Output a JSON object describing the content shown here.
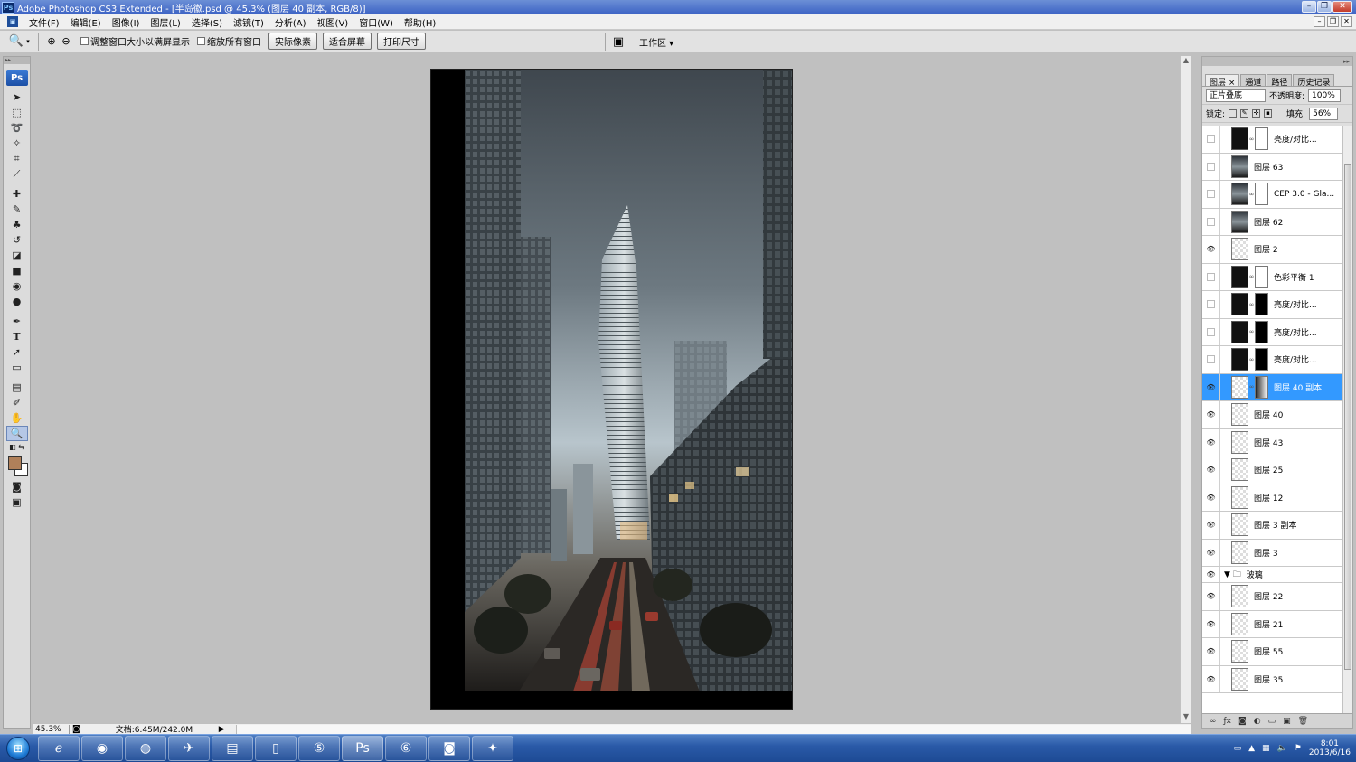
{
  "window": {
    "title": "Adobe Photoshop CS3 Extended - [半岛徽.psd @ 45.3% (图层 40 副本, RGB/8)]",
    "logo": "Ps"
  },
  "menu": [
    "文件(F)",
    "编辑(E)",
    "图像(I)",
    "图层(L)",
    "选择(S)",
    "滤镜(T)",
    "分析(A)",
    "视图(V)",
    "窗口(W)",
    "帮助(H)"
  ],
  "options": {
    "check_resize": "调整窗口大小以满屏显示",
    "check_zoom_all": "缩放所有窗口",
    "btn_actual": "实际像素",
    "btn_fit": "适合屏幕",
    "btn_print": "打印尺寸",
    "workspace": "工作区 ▾"
  },
  "toolbox": {
    "logo": "Ps"
  },
  "status": {
    "zoom": "45.3%",
    "docinfo": "文档:6.45M/242.0M"
  },
  "layers_panel": {
    "tabs": [
      "图层 ×",
      "通道",
      "路径",
      "历史记录"
    ],
    "blend_mode": "正片叠底",
    "opacity_label": "不透明度:",
    "opacity_value": "100%",
    "lock_label": "锁定:",
    "fill_label": "填充:",
    "fill_value": "56%",
    "layers": [
      {
        "name": "亮度/对比...",
        "visible": false
      },
      {
        "name": "图层 63",
        "visible": false
      },
      {
        "name": "CEP 3.0 - Gla...",
        "visible": false
      },
      {
        "name": "图层 62",
        "visible": false
      },
      {
        "name": "图层 2",
        "visible": true
      },
      {
        "name": "色彩平衡 1",
        "visible": false
      },
      {
        "name": "亮度/对比...",
        "visible": false
      },
      {
        "name": "亮度/对比...",
        "visible": false
      },
      {
        "name": "亮度/对比...",
        "visible": false
      },
      {
        "name": "图层 40 副本",
        "visible": true,
        "selected": true
      },
      {
        "name": "图层 40",
        "visible": true
      },
      {
        "name": "图层 43",
        "visible": true
      },
      {
        "name": "图层 25",
        "visible": true
      },
      {
        "name": "图层 12",
        "visible": true
      },
      {
        "name": "图层 3 副本",
        "visible": true
      },
      {
        "name": "图层 3",
        "visible": true
      },
      {
        "name": "玻璃",
        "visible": true,
        "group": true
      },
      {
        "name": "图层 22",
        "visible": true
      },
      {
        "name": "图层 21",
        "visible": true
      },
      {
        "name": "图层 55",
        "visible": true
      },
      {
        "name": "图层 35",
        "visible": true
      }
    ]
  },
  "taskbar": {
    "date": "2013/6/16",
    "time": "8:01"
  },
  "colors": {
    "foreground": "#b0805a",
    "selection": "#3399ff"
  }
}
